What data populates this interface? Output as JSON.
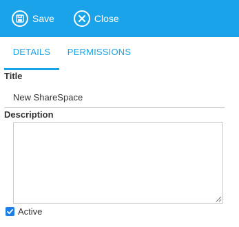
{
  "toolbar": {
    "save_label": "Save",
    "save_icon": "floppy-disk-icon",
    "close_label": "Close",
    "close_icon": "close-circle-icon",
    "background_color": "#1aa3e8"
  },
  "tabs": [
    {
      "label": "DETAILS",
      "active": true
    },
    {
      "label": "PERMISSIONS",
      "active": false
    }
  ],
  "form": {
    "title_label": "Title",
    "title_value": "New ShareSpace",
    "description_label": "Description",
    "description_value": "",
    "active_label": "Active",
    "active_checked": true
  }
}
